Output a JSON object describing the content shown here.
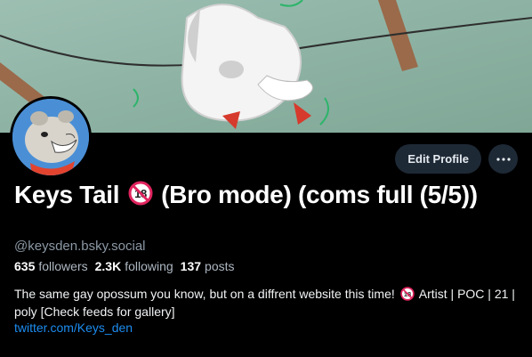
{
  "profile": {
    "display_name_part1": "Keys Tail",
    "display_name_part2": "(Bro mode) (coms full (5/5))",
    "handle": "@keysden.bsky.social",
    "edit_label": "Edit Profile",
    "more_icon": "ellipsis-icon",
    "badge_icon": "no-under-18-icon"
  },
  "stats": {
    "followers_count": "635",
    "followers_label": "followers",
    "following_count": "2.3K",
    "following_label": "following",
    "posts_count": "137",
    "posts_label": "posts"
  },
  "bio": {
    "line_part1": "The same gay opossum you know, but on a diffrent website this time!",
    "line_part2": "Artist | POC | 21 | poly [Check feeds for gallery]",
    "link": "twitter.com/Keys_den"
  },
  "colors": {
    "accent_link": "#1d8cf0",
    "button_bg": "#1e2936",
    "badge_red": "#e0245e"
  }
}
